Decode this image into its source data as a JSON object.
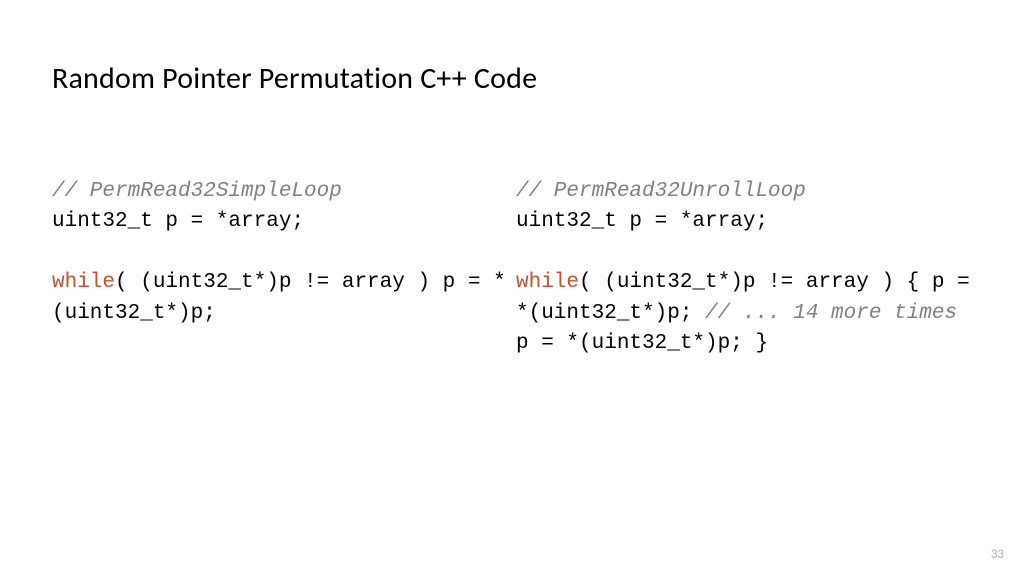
{
  "title": "Random Pointer Permutation C++ Code",
  "left": {
    "comment": "// PermRead32SimpleLoop",
    "line1": "uint32_t p = *array;",
    "kw_while": "while",
    "line2_rest": "( (uint32_t*)p != array ) p = *(uint32_t*)p;"
  },
  "right": {
    "comment": "// PermRead32UnrollLoop",
    "line1": "uint32_t p = *array;",
    "kw_while": "while",
    "line2_part1": "( (uint32_t*)p != array ) { p = *(uint32_t*)p; ",
    "comment2": "// ... 14 more times",
    "line2_part2": " p = *(uint32_t*)p; }"
  },
  "page": "33"
}
